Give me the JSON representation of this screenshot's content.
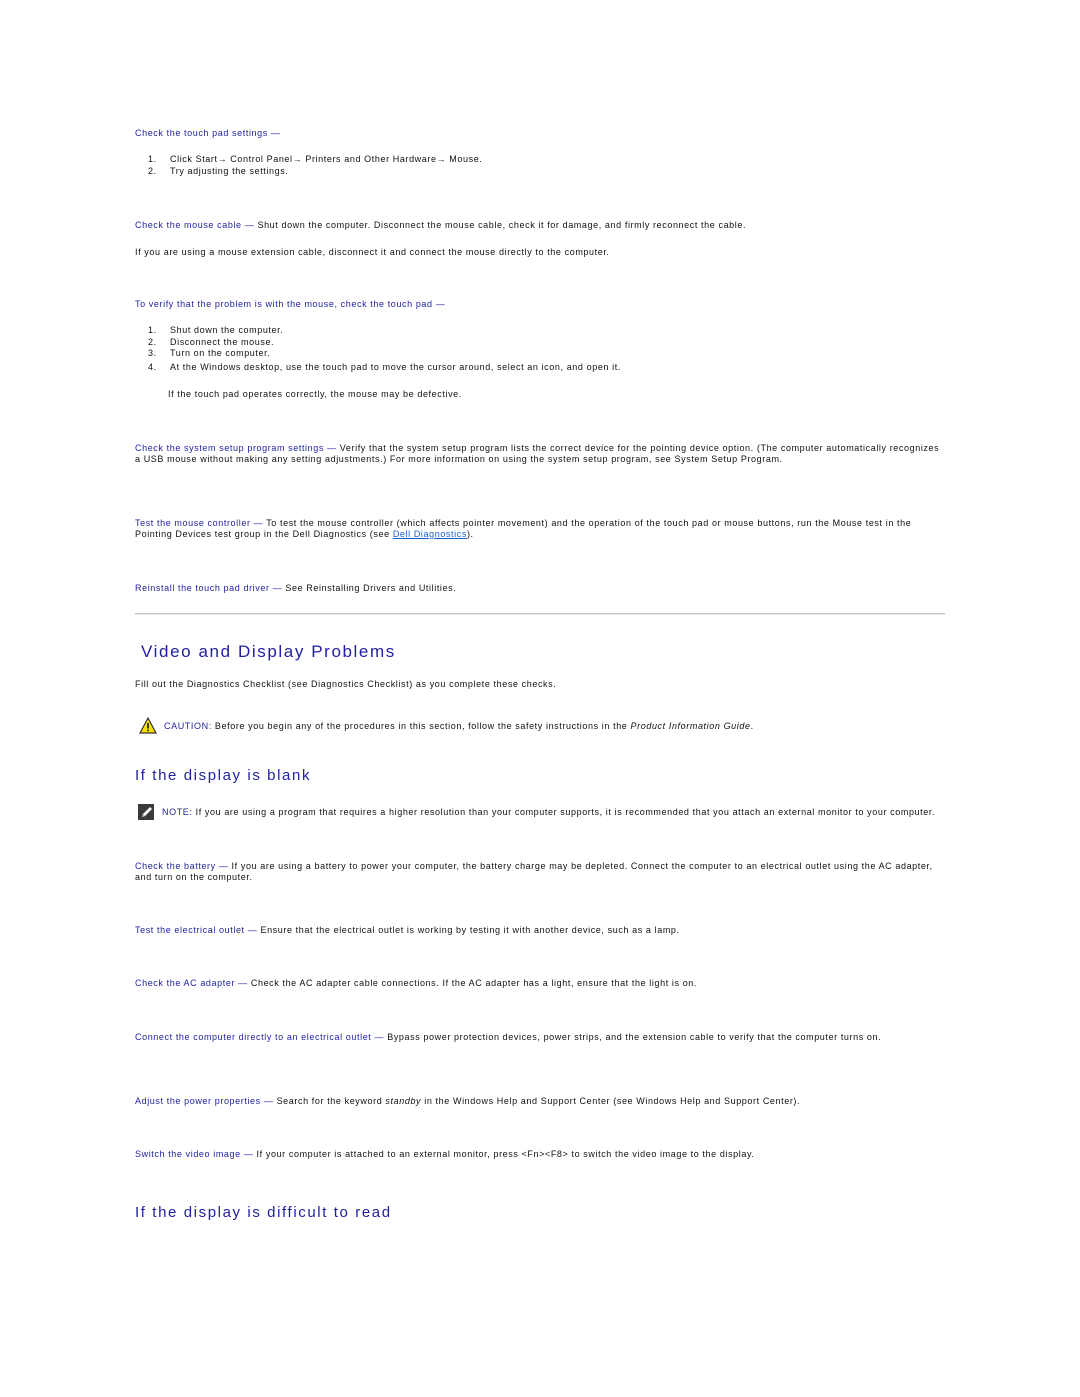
{
  "touchpad_settings": {
    "heading": "Check the touch pad settings —",
    "steps": [
      {
        "num": "1.",
        "text": "Click Start→ Control Panel→ Printers and Other Hardware→ Mouse."
      },
      {
        "num": "2.",
        "text": "Try adjusting the settings."
      }
    ]
  },
  "mouse_cable": {
    "label": "Check the mouse cable —",
    "text": " Shut down the computer. Disconnect the mouse cable, check it for damage, and firmly reconnect the cable.",
    "extension_note": "If you are using a mouse extension cable, disconnect it and connect the mouse directly to the computer."
  },
  "verify_touchpad": {
    "heading": "To verify that the problem is with the mouse, check the touch pad —",
    "steps": [
      {
        "num": "1.",
        "text": "Shut down the computer."
      },
      {
        "num": "2.",
        "text": "Disconnect the mouse."
      },
      {
        "num": "3.",
        "text": "Turn on the computer."
      },
      {
        "num": "4.",
        "text": "At the Windows desktop, use the touch pad to move the cursor around, select an icon, and open it."
      }
    ],
    "result_note": "If the touch pad operates correctly, the mouse may be defective."
  },
  "system_setup": {
    "label": "Check the system setup program settings —",
    "text": " Verify that the system setup program lists the correct device for the pointing device option. (The computer automatically recognizes a USB mouse without making any setting adjustments.) For more information on using the system setup program, see System Setup Program."
  },
  "mouse_controller": {
    "label": "Test the mouse controller —",
    "text_before": " To test the mouse controller (which affects pointer movement) and the operation of the touch pad or mouse buttons, run the Mouse test in the Pointing Devices test group in the Dell Diagnostics (see ",
    "link": "Dell Diagnostics",
    "text_after": ")."
  },
  "reinstall_driver": {
    "label": "Reinstall the touch pad driver —",
    "text": " See Reinstalling Drivers and Utilities."
  },
  "video_section": {
    "title": "Video and Display Problems",
    "intro": "Fill out the Diagnostics Checklist (see Diagnostics Checklist) as you complete these checks.",
    "caution_label": "CAUTION:",
    "caution_text": " Before you begin any of the procedures in this section, follow the safety instructions in the ",
    "caution_guide": "Product Information Guide",
    "caution_end": "."
  },
  "display_blank": {
    "title": "If the display is blank",
    "note_label": "NOTE:",
    "note_text": " If you are using a program that requires a higher resolution than your computer supports, it is recommended that you attach an external monitor to your computer.",
    "checks": [
      {
        "label": "Check the battery —",
        "text": " If you are using a battery to power your computer, the battery charge may be depleted. Connect the computer to an electrical outlet using the AC adapter, and turn on the computer."
      },
      {
        "label": "Test the electrical outlet —",
        "text": " Ensure that the electrical outlet is working by testing it with another device, such as a lamp."
      },
      {
        "label": "Check the AC adapter —",
        "text": " Check the AC adapter cable connections. If the AC adapter has a light, ensure that the light is on."
      },
      {
        "label": "Connect the computer directly to an electrical outlet —",
        "text": " Bypass power protection devices, power strips, and the extension cable to verify that the computer turns on."
      }
    ],
    "power": {
      "label": "Adjust the power properties —",
      "text_before": " Search for the keyword ",
      "keyword": "standby",
      "text_after": " in the Windows Help and Support Center (see Windows Help and Support Center)."
    },
    "switch_video": {
      "label": "Switch the video image —",
      "text": " If your computer is attached to an external monitor, press <Fn><F8> to switch the video image to the display."
    }
  },
  "display_difficult": {
    "title": "If the display is difficult to read"
  }
}
